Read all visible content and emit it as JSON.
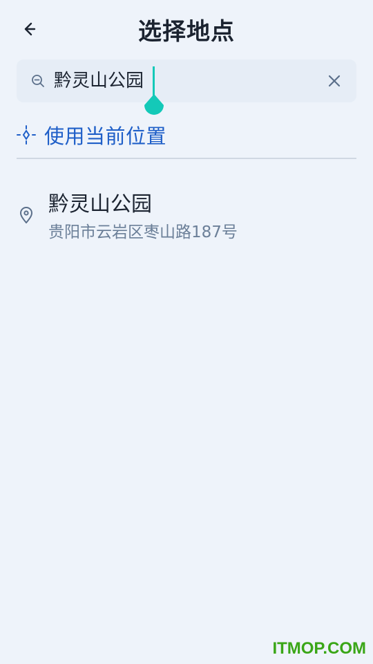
{
  "header": {
    "title": "选择地点",
    "back_icon": "arrow-left-icon"
  },
  "search": {
    "value": "黔灵山公园",
    "search_icon": "zoom-out-icon",
    "clear_icon": "close-icon",
    "caret_color": "#14c9b8"
  },
  "current_location": {
    "label": "使用当前位置",
    "icon": "crosshair-icon",
    "color": "#1f5fc8"
  },
  "results": [
    {
      "name": "黔灵山公园",
      "address": "贵阳市云岩区枣山路187号",
      "icon": "map-pin-icon"
    }
  ],
  "watermark": {
    "text": "ITMOP.COM",
    "color": "#3aa617"
  }
}
